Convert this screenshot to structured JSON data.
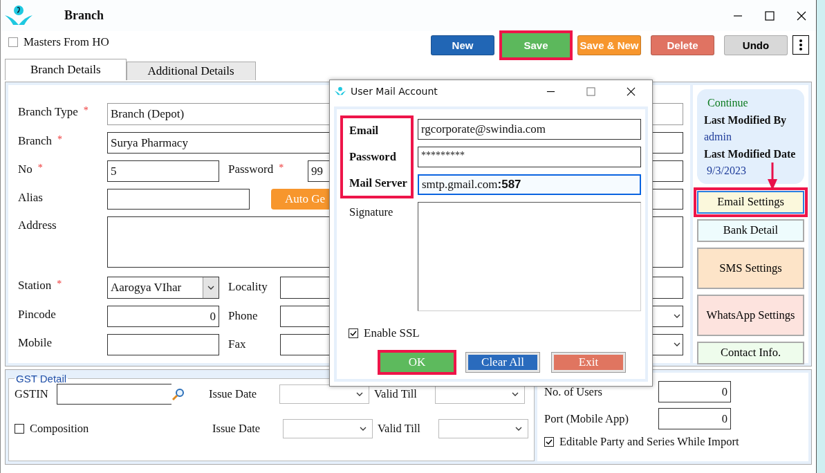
{
  "window": {
    "title": "Branch"
  },
  "masters_from_ho": {
    "label": "Masters From HO",
    "checked": false
  },
  "toolbar": [
    {
      "label": "New",
      "kind": "new",
      "highlighted": false
    },
    {
      "label": "Save",
      "kind": "save",
      "highlighted": true
    },
    {
      "label": "Save & New",
      "kind": "save_new",
      "highlighted": false
    },
    {
      "label": "Delete",
      "kind": "delete",
      "highlighted": false
    },
    {
      "label": "Undo",
      "kind": "undo",
      "highlighted": false
    }
  ],
  "tabs": [
    {
      "label": "Branch Details",
      "selected": true
    },
    {
      "label": "Additional Details",
      "selected": false
    }
  ],
  "form": {
    "branch_type": {
      "label": "Branch Type",
      "required_mark": "*",
      "value": "Branch (Depot)"
    },
    "branch": {
      "label": "Branch",
      "required_mark": "*",
      "value": "Surya Pharmacy"
    },
    "no": {
      "label": "No",
      "required_mark": "*",
      "value": "5"
    },
    "password": {
      "label": "Password",
      "required_mark": "*",
      "value": "99"
    },
    "alias": {
      "label": "Alias"
    },
    "auto_button": {
      "label": "Auto Ge"
    },
    "address": {
      "label": "Address"
    },
    "station": {
      "label": "Station",
      "required_mark": "*",
      "value": "Aarogya VIhar"
    },
    "locality": {
      "label": "Locality"
    },
    "pincode": {
      "label": "Pincode",
      "value": "0"
    },
    "phone": {
      "label": "Phone"
    },
    "mobile": {
      "label": "Mobile"
    },
    "fax": {
      "label": "Fax"
    }
  },
  "status_card": {
    "status": "Continue",
    "modified_by_label": "Last Modified By",
    "modified_by": "admin",
    "modified_date_label": "Last Modified Date",
    "modified_date": "9/3/2023"
  },
  "side_buttons": [
    {
      "label": "Email Settings",
      "color": "#fbf8dc",
      "highlighted": true
    },
    {
      "label": "Bank Detail",
      "color": "#eefcfd",
      "highlighted": false
    },
    {
      "label": "SMS Settings",
      "color": "#fde4c8",
      "highlighted": false
    },
    {
      "label": "WhatsApp Settings",
      "color": "#fde3de",
      "highlighted": false
    },
    {
      "label": "Contact Info.",
      "color": "#eefcec",
      "highlighted": false
    }
  ],
  "gst": {
    "title": "GST Detail",
    "gstin_label": "GSTIN",
    "composition": {
      "label": "Composition",
      "checked": false
    },
    "date_rows": [
      {
        "issue_label": "Issue Date",
        "valid_label": "Valid Till"
      },
      {
        "issue_label": "Issue Date",
        "valid_label": "Valid Till"
      }
    ]
  },
  "users": {
    "no_of_users": {
      "label": "No. of Users",
      "value": "0"
    },
    "port": {
      "label": "Port (Mobile App)",
      "value": "0"
    },
    "editable_import": {
      "label": "Editable Party and Series While Import",
      "checked": true
    }
  },
  "dialog": {
    "title": "User Mail Account",
    "fields": [
      {
        "label": "Email",
        "kind": "text",
        "value": "rgcorporate@swindia.com",
        "highlighted": true,
        "focused": false
      },
      {
        "label": "Password",
        "kind": "password",
        "value": "*********",
        "highlighted": true,
        "focused": false
      },
      {
        "label": "Mail Server",
        "kind": "text",
        "value": "smtp.gmail.com**:587**",
        "highlighted": true,
        "focused": true
      },
      {
        "label": "Signature",
        "kind": "textarea",
        "highlighted": false
      }
    ],
    "enable_ssl": {
      "label": "Enable SSL",
      "checked": true
    },
    "buttons": [
      {
        "label": "OK",
        "kind": "ok",
        "highlighted": true
      },
      {
        "label": "Clear All",
        "kind": "clear",
        "highlighted": false
      },
      {
        "label": "Exit",
        "kind": "exit",
        "highlighted": false
      }
    ]
  }
}
